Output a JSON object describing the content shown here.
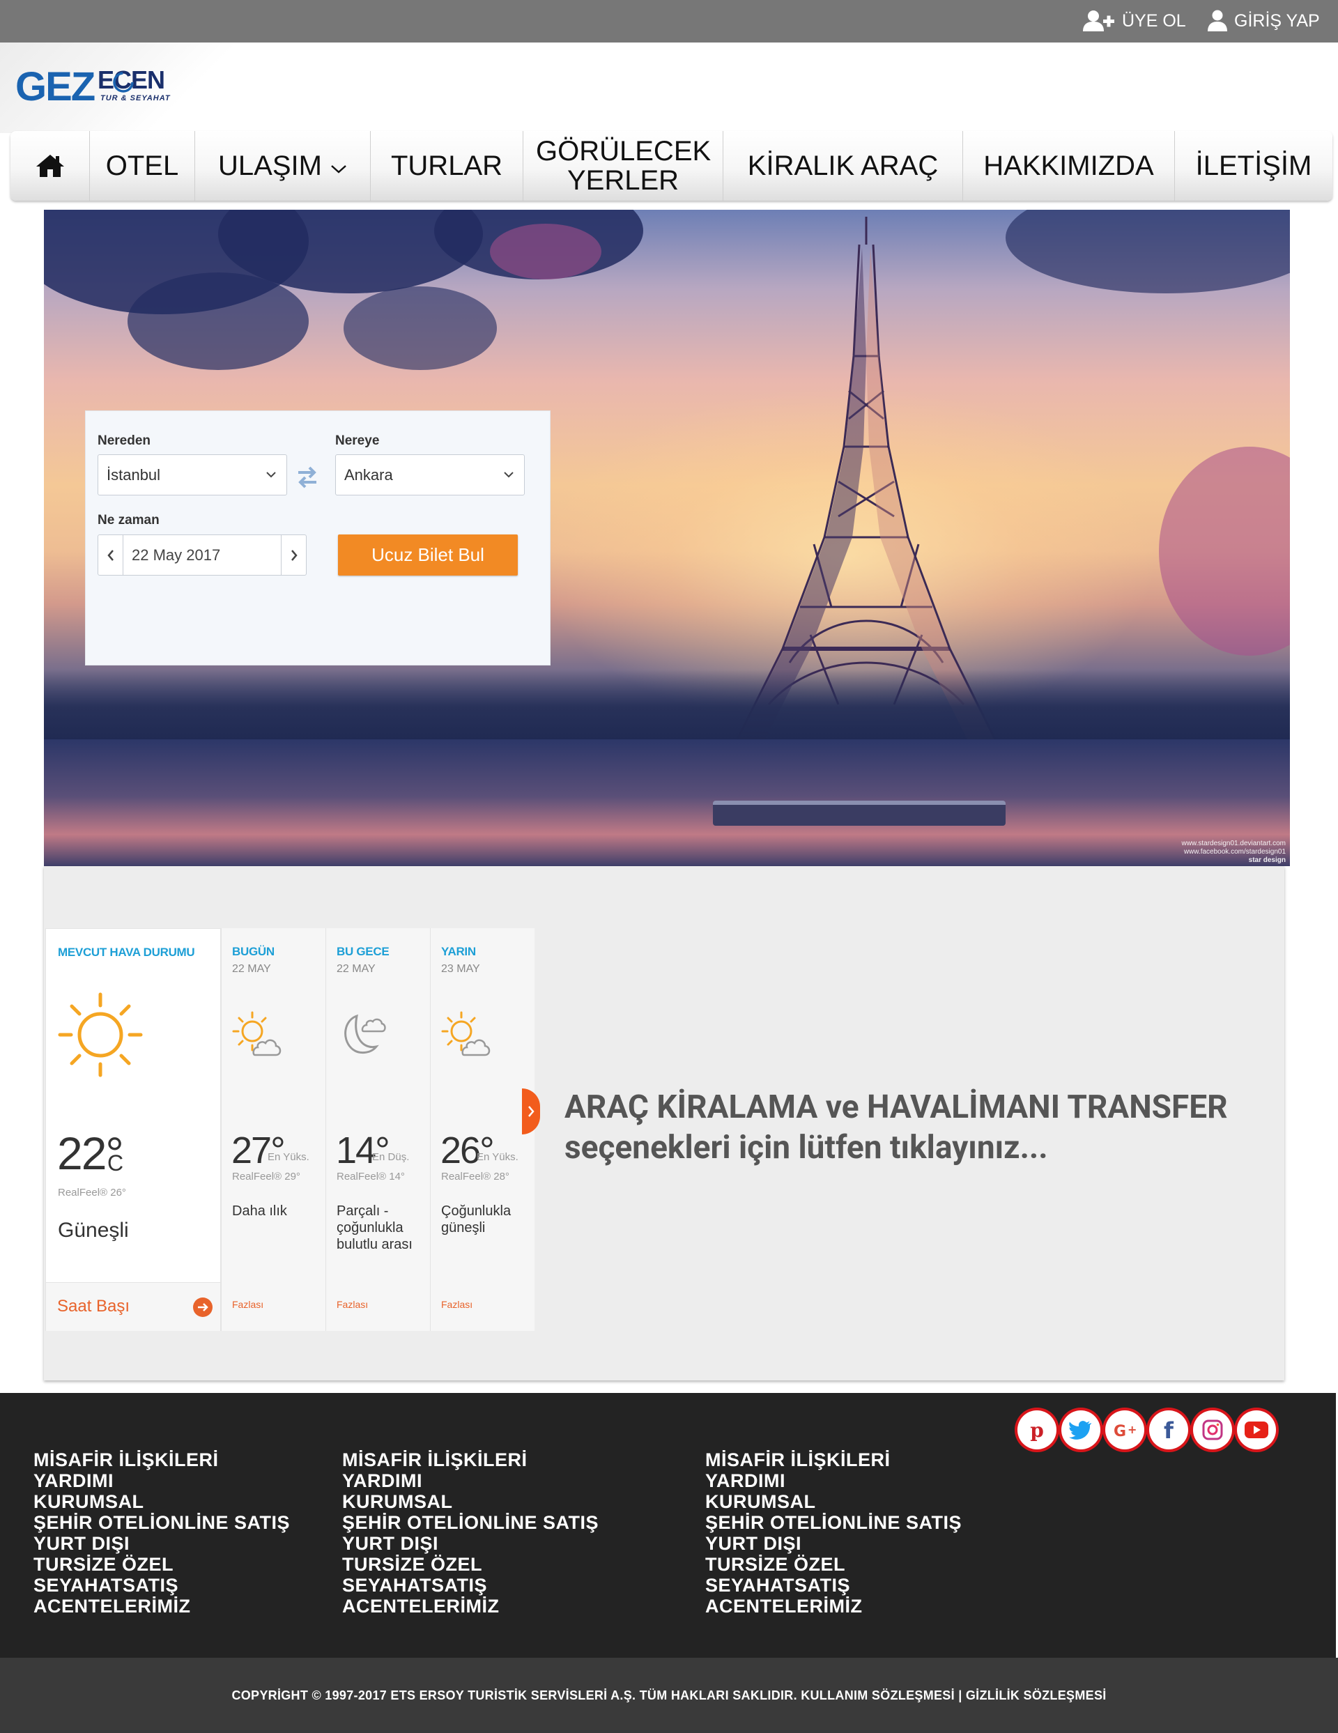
{
  "header": {
    "signup_label": "ÜYE OL",
    "login_label": "GİRİŞ YAP",
    "signup_icon": "user-plus-icon",
    "login_icon": "user-icon"
  },
  "logo": {
    "main": "GEZ",
    "secondary": "ECEN",
    "tagline": "TUR & SEYAHAT"
  },
  "nav": {
    "home_icon": "home-icon",
    "items": [
      "OTEL",
      "ULAŞIM",
      "TURLAR",
      "GÖRÜLECEK YERLER",
      "KİRALIK ARAÇ",
      "HAKKIMIZDA",
      "İLETİŞİM"
    ]
  },
  "search": {
    "from_label": "Nereden",
    "from_value": "İstanbul",
    "to_label": "Nereye",
    "to_value": "Ankara",
    "when_label": "Ne zaman",
    "date_value": "22 May 2017",
    "button_label": "Ucuz Bilet Bul"
  },
  "hero": {
    "credit_line1": "www.stardesign01.deviantart.com",
    "credit_line2": "www.facebook.com/stardesign01",
    "credit_logo": "star design"
  },
  "weather": {
    "current": {
      "heading": "MEVCUT HAVA DURUMU",
      "temp": "22°",
      "unit": "C",
      "realfeel": "RealFeel® 26°",
      "condition": "Güneşli",
      "hourly_label": "Saat Başı"
    },
    "forecast": [
      {
        "heading": "BUGÜN",
        "date": "22 MAY",
        "temp": "27°",
        "kind": "En Yüks.",
        "realfeel": "RealFeel® 29°",
        "desc": "Daha ılık",
        "more": "Fazlası"
      },
      {
        "heading": "BU GECE",
        "date": "22 MAY",
        "temp": "14°",
        "kind": "En Düş.",
        "realfeel": "RealFeel® 14°",
        "desc": "Parçalı - çoğunlukla bulutlu arası",
        "more": "Fazlası"
      },
      {
        "heading": "YARIN",
        "date": "23 MAY",
        "temp": "26°",
        "kind": "En Yüks.",
        "realfeel": "RealFeel® 28°",
        "desc": "Çoğunlukla güneşli",
        "more": "Fazlası"
      }
    ]
  },
  "promo": {
    "line1": "ARAÇ KİRALAMA ve HAVALİMANI TRANSFER",
    "line2": "seçenekleri için lütfen tıklayınız..."
  },
  "footer": {
    "columns": [
      [
        "MİSAFİR İLİŞKİLERİ",
        "YARDIMI",
        "KURUMSAL",
        "ŞEHİR OTELİONLİNE SATIŞ",
        "YURT DIŞI",
        "TURSİZE ÖZEL",
        "SEYAHATSATIŞ",
        "ACENTELERİMİZ"
      ],
      [
        "MİSAFİR İLİŞKİLERİ",
        "YARDIMI",
        "KURUMSAL",
        "ŞEHİR OTELİONLİNE SATIŞ",
        "YURT DIŞI",
        "TURSİZE ÖZEL",
        "SEYAHATSATIŞ",
        "ACENTELERİMİZ"
      ],
      [
        "MİSAFİR İLİŞKİLERİ",
        "YARDIMI",
        "KURUMSAL",
        "ŞEHİR OTELİONLİNE SATIŞ",
        "YURT DIŞI",
        "TURSİZE ÖZEL",
        "SEYAHATSATIŞ",
        "ACENTELERİMİZ"
      ]
    ],
    "social": [
      "pinterest-icon",
      "twitter-icon",
      "google-plus-icon",
      "facebook-icon",
      "instagram-icon",
      "youtube-icon"
    ],
    "copyright": "COPYRİGHT © 1997-2017 ETS ERSOY TURİSTİK SERVİSLERİ A.Ş. TÜM HAKLARI SAKLIDIR. KULLANIM SÖZLEŞMESİ | GİZLİLİK SÖZLEŞMESİ"
  },
  "colors": {
    "topbar": "#777777",
    "accent_orange": "#f28a24",
    "weather_blue": "#1d9fd6",
    "sun_orange": "#f5a623",
    "footer_bg": "#232323",
    "social_ring": "#d8151a"
  }
}
